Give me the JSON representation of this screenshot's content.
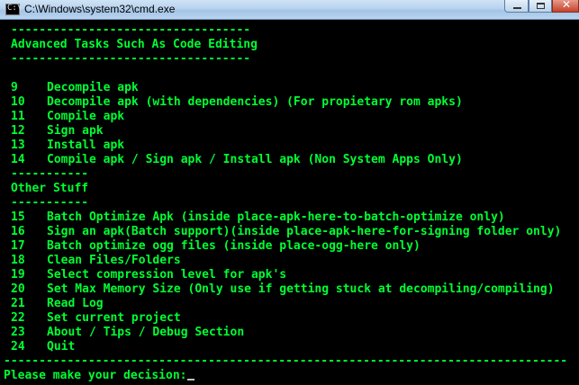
{
  "window": {
    "title": "C:\\Windows\\system32\\cmd.exe",
    "icon": "cmd-icon"
  },
  "console": {
    "colors": {
      "text": "#00ff33",
      "background": "#000000"
    },
    "rule_short": "----------------------------------",
    "rule_mini": "-----------",
    "rule_full": "--------------------------------------------------------------------------------",
    "sections": {
      "advanced": "Advanced Tasks Such As Code Editing",
      "other": "Other Stuff"
    },
    "advanced_items": [
      {
        "num": "9",
        "text": "Decompile apk"
      },
      {
        "num": "10",
        "text": "Decompile apk (with dependencies) (For propietary rom apks)"
      },
      {
        "num": "11",
        "text": "Compile apk"
      },
      {
        "num": "12",
        "text": "Sign apk"
      },
      {
        "num": "13",
        "text": "Install apk"
      },
      {
        "num": "14",
        "text": "Compile apk / Sign apk / Install apk (Non System Apps Only)"
      }
    ],
    "other_items": [
      {
        "num": "15",
        "text": "Batch Optimize Apk (inside place-apk-here-to-batch-optimize only)"
      },
      {
        "num": "16",
        "text": "Sign an apk(Batch support)(inside place-apk-here-for-signing folder only)"
      },
      {
        "num": "17",
        "text": "Batch optimize ogg files (inside place-ogg-here only)"
      },
      {
        "num": "18",
        "text": "Clean Files/Folders"
      },
      {
        "num": "19",
        "text": "Select compression level for apk's"
      },
      {
        "num": "20",
        "text": "Set Max Memory Size (Only use if getting stuck at decompiling/compiling)"
      },
      {
        "num": "21",
        "text": "Read Log"
      },
      {
        "num": "22",
        "text": "Set current project"
      },
      {
        "num": "23",
        "text": "About / Tips / Debug Section"
      },
      {
        "num": "24",
        "text": "Quit"
      }
    ],
    "prompt": "Please make your decision:"
  }
}
